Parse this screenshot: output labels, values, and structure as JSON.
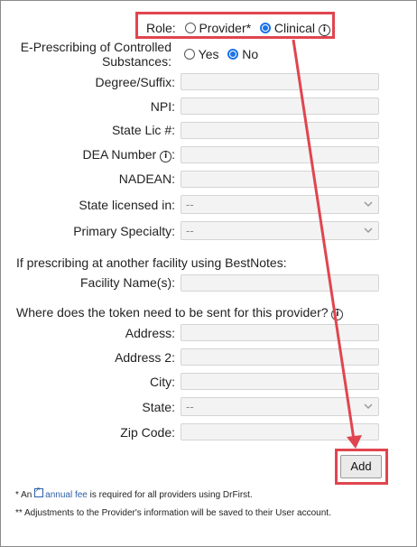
{
  "role": {
    "label": "Role:",
    "options": [
      {
        "label": "Provider*",
        "selected": false
      },
      {
        "label": "Clinical",
        "selected": true
      }
    ]
  },
  "eprescribing": {
    "label_line1": "E-Prescribing of Controlled",
    "label_line2": "Substances:",
    "options": [
      {
        "label": "Yes",
        "selected": false
      },
      {
        "label": "No",
        "selected": true
      }
    ]
  },
  "fields": {
    "degree": {
      "label": "Degree/Suffix:",
      "value": ""
    },
    "npi": {
      "label": "NPI:",
      "value": ""
    },
    "state_lic": {
      "label": "State Lic #:",
      "value": ""
    },
    "dea": {
      "label": "DEA Number",
      "value": ""
    },
    "nadean": {
      "label": "NADEAN:",
      "value": ""
    },
    "state_licensed_in": {
      "label": "State licensed in:",
      "value": "--"
    },
    "primary_specialty": {
      "label": "Primary Specialty:",
      "value": "--"
    }
  },
  "facility": {
    "heading": "If prescribing at another facility using BestNotes:",
    "label": "Facility Name(s):",
    "value": ""
  },
  "token": {
    "heading": "Where does the token need to be sent for this provider?",
    "address": {
      "label": "Address:",
      "value": ""
    },
    "address2": {
      "label": "Address 2:",
      "value": ""
    },
    "city": {
      "label": "City:",
      "value": ""
    },
    "state": {
      "label": "State:",
      "value": "--"
    },
    "zip": {
      "label": "Zip Code:",
      "value": ""
    }
  },
  "add_button": "Add",
  "footnotes": {
    "fee_prefix": "* An",
    "fee_link": "annual fee",
    "fee_suffix": "is required for all providers using DrFirst.",
    "adjustments": "** Adjustments to the Provider's information will be saved to their User account."
  },
  "colors": {
    "highlight": "#e0454f",
    "radio_accent": "#1a73e8",
    "link": "#2b5ea7"
  }
}
